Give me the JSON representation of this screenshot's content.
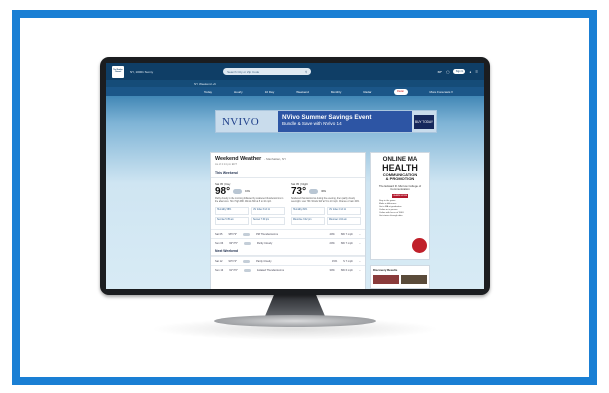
{
  "topbar": {
    "logo": "The Weather Channel",
    "location": "NY, 10001 Sunny",
    "search_placeholder": "Search City or Zip Code",
    "temp": "68°",
    "pill": "Sign In"
  },
  "subbar": {
    "text": "NY Weekend +6"
  },
  "nav": {
    "items": [
      "Today",
      "Hourly",
      "10 Day",
      "Weekend",
      "Monthly",
      "Radar"
    ],
    "radar_badge": "Radar",
    "more": "More Forecasts ▾"
  },
  "ad": {
    "logo": "NVIVO",
    "headline": "NVivo Summer Savings Event",
    "sub": "Bundle & Save with NVivo 14",
    "cta": "BUY TODAY"
  },
  "weekend": {
    "title": "Weekend Weather",
    "subtitle": "- Manhattan, NY",
    "updated": "As of 2:14 pm EDT",
    "section": "This Weekend",
    "days": [
      {
        "name": "Sat 05 | Day",
        "temp": "98°",
        "precip": "10%",
        "desc": "Partly cloudy in the morning followed by scattered thunderstorms in the afternoon. Hot. High 98F. Winds SW at 5 to 10 mph."
      },
      {
        "name": "Sat 05 | Night",
        "temp": "73°",
        "precip": "40%",
        "desc": "Scattered thunderstorms during the evening, then partly cloudy overnight. Low 73F. Winds SW at 5 to 10 mph. Chance of rain 40%."
      }
    ],
    "cells": [
      "Humidity 58%",
      "UV Index 8 of 11",
      "Sunrise 5:35 am",
      "Sunset 7:30 pm",
      "Humidity 81%",
      "UV Index 0 of 11",
      "Moonrise 3:42 pm",
      "Moonset 1:04 am"
    ],
    "rows": [
      {
        "day": "Sat 05",
        "temp": "98°/73°",
        "cond": "PM Thunderstorms",
        "precip": "40%",
        "wind": "SW 7 mph"
      },
      {
        "day": "Sun 06",
        "temp": "93°/75°",
        "cond": "Partly Cloudy",
        "precip": "20%",
        "wind": "SW 7 mph"
      }
    ],
    "next_section": "Next Weekend",
    "next_rows": [
      {
        "day": "Sat 12",
        "temp": "90°/74°",
        "cond": "Partly Cloudy",
        "precip": "15%",
        "wind": "S 7 mph"
      },
      {
        "day": "Sun 13",
        "temp": "91°/76°",
        "cond": "Isolated Thunderstorms",
        "precip": "30%",
        "wind": "SW 6 mph"
      }
    ]
  },
  "side_ad": {
    "l1": "ONLINE MA",
    "l2": "HEALTH",
    "l3": "COMMUNICATION",
    "l4": "& PROMOTION",
    "l5": "The Edward R. Murrow College of Communication",
    "cta": "LEARN MORE",
    "bullets": [
      "Stay in the game",
      "Make a difference",
      "Get a MA at graduation",
      "Online or in person",
      "Online with focus at WSU",
      "Get stories through data"
    ]
  },
  "discovery": {
    "title": "Discovery Results"
  }
}
